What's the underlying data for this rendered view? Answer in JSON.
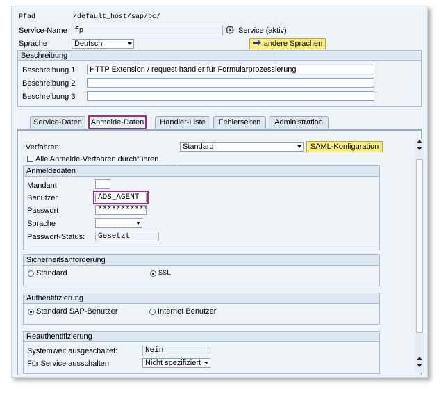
{
  "header": {
    "pfad_label": "Pfad",
    "pfad_value": "/default_host/sap/bc/",
    "service_name_label": "Service-Name",
    "service_name_value": "fp",
    "service_status": "Service (aktiv)",
    "sprache_label": "Sprache",
    "sprache_value": "Deutsch",
    "andere_sprachen_label": "andere Sprachen"
  },
  "beschreibung": {
    "title": "Beschreibung",
    "rows": [
      {
        "label": "Beschreibung 1",
        "value": "HTTP Extension / request handler für Formularprozessierung"
      },
      {
        "label": "Beschreibung 2",
        "value": ""
      },
      {
        "label": "Beschreibung 3",
        "value": ""
      }
    ]
  },
  "tabs": [
    {
      "label": "Service-Daten",
      "active": false
    },
    {
      "label": "Anmelde-Daten",
      "active": true
    },
    {
      "label": "Handler-Liste",
      "active": false
    },
    {
      "label": "Fehlerseiten",
      "active": false
    },
    {
      "label": "Administration",
      "active": false
    }
  ],
  "anmelde": {
    "verfahren_label": "Verfahren:",
    "verfahren_value": "Standard",
    "saml_button": "SAML-Konfiguration",
    "alle_verfahren_label": "Alle Anmelde-Verfahren durchführen",
    "anmeldedaten": {
      "title": "Anmeldedaten",
      "mandant_label": "Mandant",
      "mandant_value": "",
      "benutzer_label": "Benutzer",
      "benutzer_value": "ADS_AGENT",
      "passwort_label": "Passwort",
      "passwort_value": "************",
      "sprache_label": "Sprache",
      "sprache_value": "",
      "status_label": "Passwort-Status:",
      "status_value": "Gesetzt"
    },
    "sicherheit": {
      "title": "Sicherheitsanforderung",
      "opt_standard": "Standard",
      "opt_ssl": "SSL",
      "selected": "SSL"
    },
    "authentifizierung": {
      "title": "Authentifizierung",
      "opt_sap": "Standard SAP-Benutzer",
      "opt_internet": "Internet Benutzer",
      "selected": "Standard SAP-Benutzer"
    },
    "reauth": {
      "title": "Reauthentifizierung",
      "systemweit_label": "Systemweit ausgeschaltet:",
      "systemweit_value": "Nein",
      "service_label": "Für Service ausschalten:",
      "service_value": "Nicht spezifiziert"
    }
  },
  "colors": {
    "highlight": "#a1298b",
    "button_yellow": "#fdf07a",
    "panel_bg": "#eef3f8"
  }
}
